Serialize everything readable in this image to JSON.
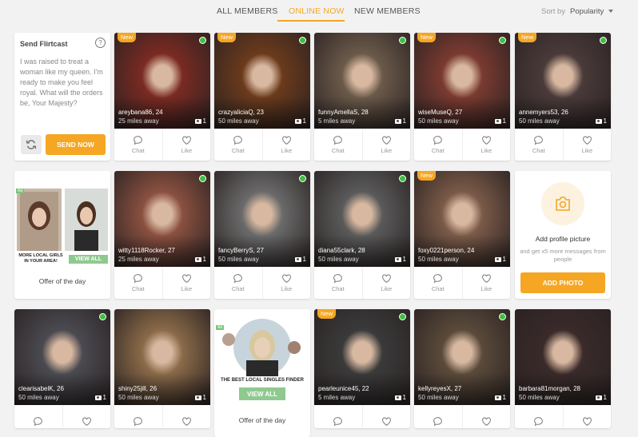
{
  "tabs": {
    "all_members": "ALL MEMBERS",
    "online_now": "ONLINE NOW",
    "new_members": "NEW MEMBERS",
    "active": "online_now"
  },
  "sort": {
    "label": "Sort by",
    "value": "Popularity"
  },
  "flirtcast": {
    "title": "Send Flirtcast",
    "help": "?",
    "message": "I was raised to treat a woman like my queen. I'm ready to make you feel royal. What will the orders be, Your Majesty?",
    "send_label": "SEND NOW"
  },
  "actions": {
    "chat": "Chat",
    "like": "Like"
  },
  "badge_new": "New",
  "offers": {
    "offer1_headline": "MORE LOCAL GIRLS IN YOUR AREA!",
    "offer1_button": "VIEW ALL",
    "offer2_headline": "THE BEST LOCAL SINGLES FINDER",
    "offer2_button": "VIEW ALL",
    "offer_label": "Offer of the day",
    "ad_tag": "Ad"
  },
  "add_photo": {
    "title": "Add profile picture",
    "subtitle": "and get x5 more messages from people",
    "button": "ADD PHOTO"
  },
  "colors": {
    "accent": "#f5a623",
    "online": "#3fbf3f"
  },
  "members": [
    {
      "name": "areybana86",
      "age": "24",
      "distance": "25 miles away",
      "photos": "1",
      "is_new": true,
      "online": true,
      "tone": "#7a2a22"
    },
    {
      "name": "crazyaliciaQ",
      "age": "23",
      "distance": "50 miles away",
      "photos": "1",
      "is_new": true,
      "online": true,
      "tone": "#6b3a1c"
    },
    {
      "name": "funnyAmellaS",
      "age": "28",
      "distance": "5 miles away",
      "photos": "1",
      "is_new": false,
      "online": true,
      "tone": "#6b5a4a"
    },
    {
      "name": "wiseMuseQ",
      "age": "27",
      "distance": "50 miles away",
      "photos": "1",
      "is_new": true,
      "online": true,
      "tone": "#7a3a30"
    },
    {
      "name": "annemyers53",
      "age": "26",
      "distance": "50 miles away",
      "photos": "1",
      "is_new": true,
      "online": true,
      "tone": "#4a3a3a"
    },
    {
      "name": "witty1118Rocker",
      "age": "27",
      "distance": "25 miles away",
      "photos": "1",
      "is_new": false,
      "online": true,
      "tone": "#8a5040"
    },
    {
      "name": "fancyBerryS",
      "age": "27",
      "distance": "50 miles away",
      "photos": "1",
      "is_new": false,
      "online": true,
      "tone": "#6a6a6a"
    },
    {
      "name": "diana55clark",
      "age": "28",
      "distance": "50 miles away",
      "photos": "1",
      "is_new": false,
      "online": true,
      "tone": "#5a5a5a"
    },
    {
      "name": "foxy0221person",
      "age": "24",
      "distance": "50 miles away",
      "photos": "1",
      "is_new": true,
      "online": false,
      "tone": "#7a5a48"
    },
    {
      "name": "clearisabelK",
      "age": "26",
      "distance": "50 miles away",
      "photos": "1",
      "is_new": false,
      "online": true,
      "tone": "#4a4a50"
    },
    {
      "name": "shiny25jill",
      "age": "26",
      "distance": "50 miles away",
      "photos": "1",
      "is_new": false,
      "online": false,
      "tone": "#8a6a48"
    },
    {
      "name": "pearleunice45",
      "age": "22",
      "distance": "5 miles away",
      "photos": "1",
      "is_new": true,
      "online": true,
      "tone": "#3a3a3a"
    },
    {
      "name": "kellyreyesX",
      "age": "27",
      "distance": "50 miles away",
      "photos": "1",
      "is_new": false,
      "online": true,
      "tone": "#5a4a3a"
    },
    {
      "name": "barbara81morgan",
      "age": "28",
      "distance": "50 miles away",
      "photos": "1",
      "is_new": false,
      "online": false,
      "tone": "#3a2a2a"
    }
  ]
}
